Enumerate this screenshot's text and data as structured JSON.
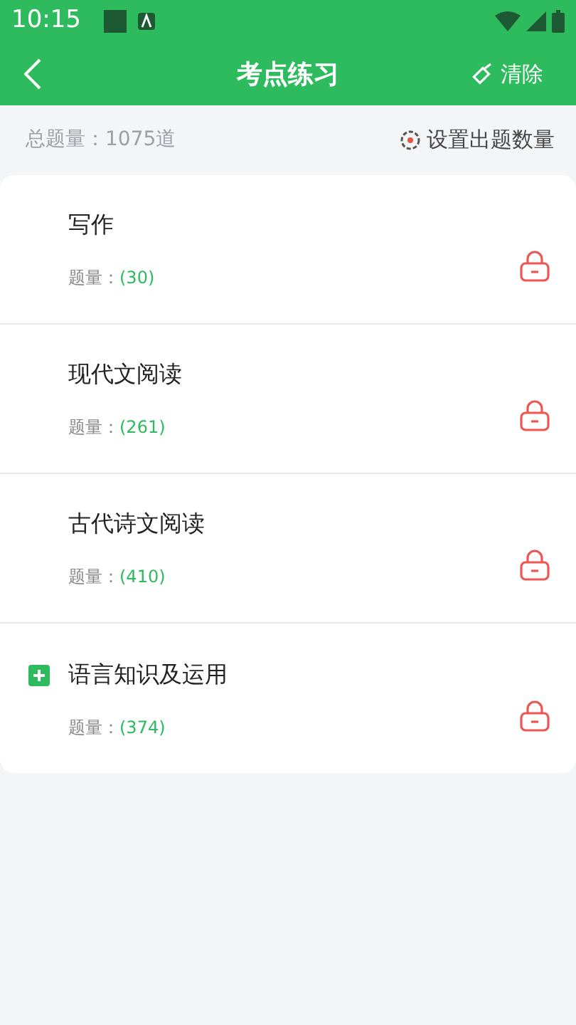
{
  "status_bar": {
    "time": "10:15"
  },
  "app_bar": {
    "title": "考点练习",
    "action": "清除"
  },
  "summary": {
    "total": "总题量：1075道",
    "settings": "设置出题数量"
  },
  "items": [
    {
      "kind": "leaf",
      "title": "写作",
      "count_label": "题量：",
      "count": "(30)",
      "locked": true
    },
    {
      "kind": "leaf",
      "title": "现代文阅读",
      "count_label": "题量：",
      "count": "(261)",
      "locked": true
    },
    {
      "kind": "leaf",
      "title": "古代诗文阅读",
      "count_label": "题量：",
      "count": "(410)",
      "locked": true
    },
    {
      "kind": "group",
      "title": "语言知识及运用",
      "count_label": "题量：",
      "count": "(374)",
      "locked": true,
      "expanded": false
    }
  ]
}
